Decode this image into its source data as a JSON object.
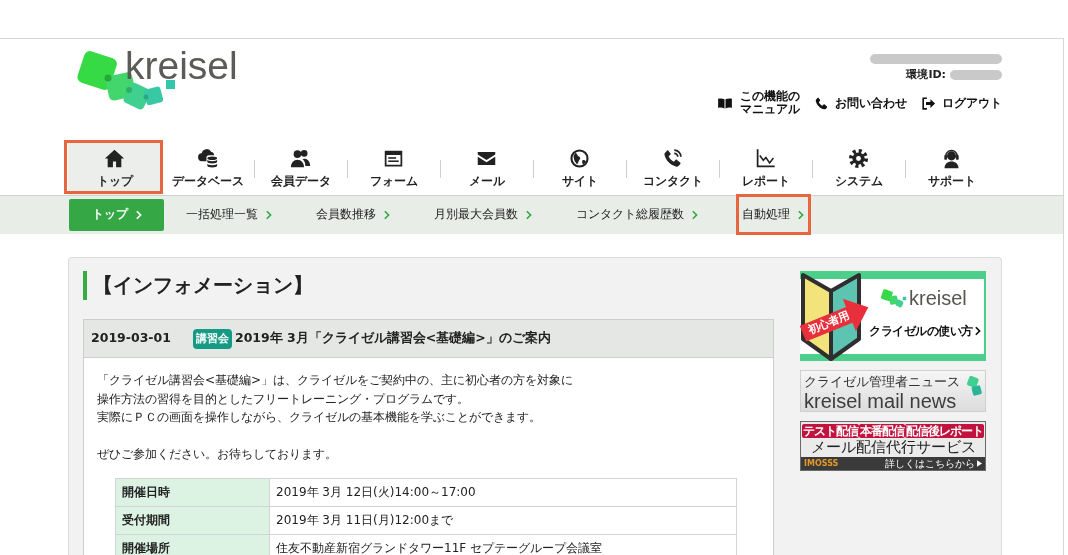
{
  "header": {
    "logo": "kreisel",
    "account": {
      "email_blurred": true,
      "env_label": "環境ID:",
      "env_id_blurred": true
    },
    "links": [
      {
        "kind": "manual",
        "lines": [
          "この機能の",
          "マニュアル"
        ]
      },
      {
        "kind": "phone",
        "lines": [
          "お問い合わせ"
        ]
      },
      {
        "kind": "logout",
        "lines": [
          "ログアウト"
        ]
      }
    ]
  },
  "global_nav": [
    {
      "kind": "home",
      "label": "トップ",
      "selected": true,
      "highlighted": true
    },
    {
      "kind": "database",
      "label": "データベース",
      "selected": false,
      "highlighted": false
    },
    {
      "kind": "members",
      "label": "会員データ",
      "selected": false,
      "highlighted": false
    },
    {
      "kind": "form",
      "label": "フォーム",
      "selected": false,
      "highlighted": false
    },
    {
      "kind": "mail",
      "label": "メール",
      "selected": false,
      "highlighted": false
    },
    {
      "kind": "site",
      "label": "サイト",
      "selected": false,
      "highlighted": false
    },
    {
      "kind": "contact",
      "label": "コンタクト",
      "selected": false,
      "highlighted": false
    },
    {
      "kind": "report",
      "label": "レポート",
      "selected": false,
      "highlighted": false
    },
    {
      "kind": "system",
      "label": "システム",
      "selected": false,
      "highlighted": false
    },
    {
      "kind": "support",
      "label": "サポート",
      "selected": false,
      "highlighted": false
    }
  ],
  "sub_nav": [
    {
      "label": "トップ",
      "selected": true,
      "highlighted": false
    },
    {
      "label": "一括処理一覧",
      "selected": false,
      "highlighted": false
    },
    {
      "label": "会員数推移",
      "selected": false,
      "highlighted": false
    },
    {
      "label": "月別最大会員数",
      "selected": false,
      "highlighted": false
    },
    {
      "label": "コンタクト総履歴数",
      "selected": false,
      "highlighted": false
    },
    {
      "label": "自動処理",
      "selected": false,
      "highlighted": true
    }
  ],
  "information": {
    "title": "【インフォメーション】",
    "news": [
      {
        "date": "2019-03-01",
        "tag": "講習会",
        "title": "2019年 3月「クライゼル講習会<基礎編>」のご案内",
        "paragraphs": [
          [
            "「クライゼル講習会<基礎編>」は、クライゼルをご契約中の、主に初心者の方を対象に",
            "操作方法の習得を目的としたフリートレーニング・プログラムです。",
            "実際にＰＣの画面を操作しながら、クライゼルの基本機能を学ぶことができます。"
          ],
          [
            "ぜひご参加ください。お待ちしております。"
          ]
        ],
        "details": [
          {
            "label": "開催日時",
            "value": "2019年 3月 12日(火)14:00～17:00"
          },
          {
            "label": "受付期間",
            "value": "2019年 3月 11日(月)12:00まで"
          },
          {
            "label": "開催場所",
            "value": "住友不動産新宿グランドタワー11F セプテーグループ会議室"
          }
        ]
      }
    ]
  },
  "banners": [
    {
      "kind": "beginner",
      "ribbon": "初心者用",
      "logo": "kreisel",
      "caption": "クライゼルの使い方"
    },
    {
      "kind": "mail_news",
      "title": "クライゼル管理者ニュース",
      "subtitle": "kreisel mail news"
    },
    {
      "kind": "service",
      "tags": [
        "テスト配信",
        "本番配信",
        "配信後レポート"
      ],
      "title": "メール配信代行サービス",
      "brand": "IMOSSS",
      "link": "詳しくはこちらから"
    }
  ]
}
